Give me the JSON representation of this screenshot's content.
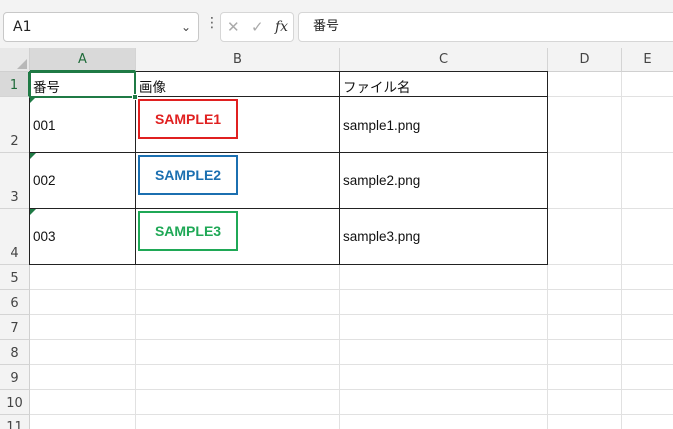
{
  "formula_bar": {
    "name_box": "A1",
    "formula": "番号"
  },
  "columns": [
    "A",
    "B",
    "C",
    "D",
    "E"
  ],
  "rows": [
    "1",
    "2",
    "3",
    "4",
    "5",
    "6",
    "7",
    "8",
    "9",
    "10",
    "11"
  ],
  "table": {
    "header": {
      "a": "番号",
      "b": "画像",
      "c": "ファイル名"
    },
    "rows": [
      {
        "a": "001",
        "image_label": "SAMPLE1",
        "c": "sample1.png",
        "color": "#e02020"
      },
      {
        "a": "002",
        "image_label": "SAMPLE2",
        "c": "sample2.png",
        "color": "#1b6fb0"
      },
      {
        "a": "003",
        "image_label": "SAMPLE3",
        "c": "sample3.png",
        "color": "#1fa856"
      }
    ]
  },
  "colors": {
    "accent": "#1f7a45"
  }
}
